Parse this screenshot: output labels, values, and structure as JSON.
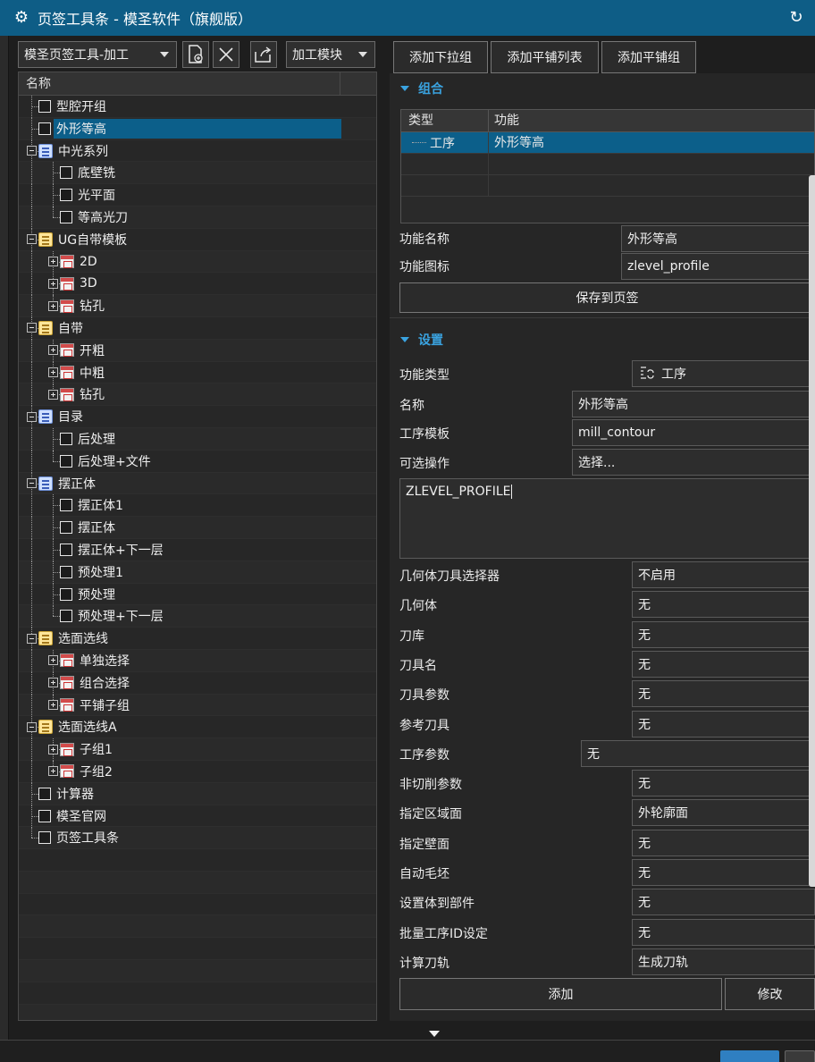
{
  "window": {
    "title": "页签工具条 - 模圣软件（旗舰版）"
  },
  "toolbar": {
    "tab_combo": "模圣页签工具-加工",
    "module_combo": "加工模块"
  },
  "top_buttons": {
    "add_dropdown_group": "添加下拉组",
    "add_tile_list": "添加平铺列表",
    "add_tile_group": "添加平铺组"
  },
  "tree": {
    "header": "名称",
    "items": [
      {
        "label": "型腔开组",
        "level": 1,
        "icon": "checkbox",
        "expander": ""
      },
      {
        "label": "外形等高",
        "level": 1,
        "icon": "checkbox",
        "expander": "",
        "selected": true
      },
      {
        "label": "中光系列",
        "level": 1,
        "icon": "list-blue",
        "expander": "minus"
      },
      {
        "label": "底壁铣",
        "level": 2,
        "icon": "checkbox",
        "expander": ""
      },
      {
        "label": "光平面",
        "level": 2,
        "icon": "checkbox",
        "expander": ""
      },
      {
        "label": "等高光刀",
        "level": 2,
        "icon": "checkbox",
        "expander": ""
      },
      {
        "label": "UG自带模板",
        "level": 1,
        "icon": "list-yellow",
        "expander": "minus"
      },
      {
        "label": "2D",
        "level": 2,
        "icon": "grid",
        "expander": "plus"
      },
      {
        "label": "3D",
        "level": 2,
        "icon": "grid",
        "expander": "plus"
      },
      {
        "label": "钻孔",
        "level": 2,
        "icon": "grid",
        "expander": "plus"
      },
      {
        "label": "自带",
        "level": 1,
        "icon": "list-yellow",
        "expander": "minus"
      },
      {
        "label": "开粗",
        "level": 2,
        "icon": "grid",
        "expander": "plus"
      },
      {
        "label": "中粗",
        "level": 2,
        "icon": "grid",
        "expander": "plus"
      },
      {
        "label": "钻孔",
        "level": 2,
        "icon": "grid",
        "expander": "plus"
      },
      {
        "label": "目录",
        "level": 1,
        "icon": "list-blue",
        "expander": "minus"
      },
      {
        "label": "后处理",
        "level": 2,
        "icon": "checkbox",
        "expander": ""
      },
      {
        "label": "后处理+文件",
        "level": 2,
        "icon": "checkbox",
        "expander": ""
      },
      {
        "label": "摆正体",
        "level": 1,
        "icon": "list-blue",
        "expander": "minus"
      },
      {
        "label": "摆正体1",
        "level": 2,
        "icon": "checkbox",
        "expander": ""
      },
      {
        "label": "摆正体",
        "level": 2,
        "icon": "checkbox",
        "expander": ""
      },
      {
        "label": "摆正体+下一层",
        "level": 2,
        "icon": "checkbox",
        "expander": ""
      },
      {
        "label": "预处理1",
        "level": 2,
        "icon": "checkbox",
        "expander": ""
      },
      {
        "label": "预处理",
        "level": 2,
        "icon": "checkbox",
        "expander": ""
      },
      {
        "label": "预处理+下一层",
        "level": 2,
        "icon": "checkbox",
        "expander": ""
      },
      {
        "label": "选面选线",
        "level": 1,
        "icon": "list-yellow",
        "expander": "minus"
      },
      {
        "label": "单独选择",
        "level": 2,
        "icon": "grid",
        "expander": "plus"
      },
      {
        "label": "组合选择",
        "level": 2,
        "icon": "grid",
        "expander": "plus"
      },
      {
        "label": "平铺子组",
        "level": 2,
        "icon": "grid",
        "expander": "plus"
      },
      {
        "label": "选面选线A",
        "level": 1,
        "icon": "list-yellow",
        "expander": "minus"
      },
      {
        "label": "子组1",
        "level": 2,
        "icon": "grid",
        "expander": "plus"
      },
      {
        "label": "子组2",
        "level": 2,
        "icon": "grid",
        "expander": "plus"
      },
      {
        "label": "计算器",
        "level": 1,
        "icon": "checkbox",
        "expander": ""
      },
      {
        "label": "模圣官网",
        "level": 1,
        "icon": "checkbox",
        "expander": ""
      },
      {
        "label": "页签工具条",
        "level": 1,
        "icon": "checkbox",
        "expander": ""
      }
    ]
  },
  "group_section": {
    "title": "组合",
    "col_type": "类型",
    "col_function": "功能",
    "row_type": "工序",
    "row_function": "外形等高",
    "name_label": "功能名称",
    "name_value": "外形等高",
    "icon_label": "功能图标",
    "icon_value": "zlevel_profile",
    "save_button": "保存到页签"
  },
  "settings_section": {
    "title": "设置",
    "func_type_label": "功能类型",
    "func_type_value": "工序",
    "name_label": "名称",
    "name_value": "外形等高",
    "template_label": "工序模板",
    "template_value": "mill_contour",
    "optional_label": "可选操作",
    "optional_value": "选择...",
    "textarea_value": "ZLEVEL_PROFILE",
    "rows": [
      {
        "label": "几何体刀具选择器",
        "value": "不启用"
      },
      {
        "label": "几何体",
        "value": "无"
      },
      {
        "label": "刀库",
        "value": "无"
      },
      {
        "label": "刀具名",
        "value": "无"
      },
      {
        "label": "刀具参数",
        "value": "无"
      },
      {
        "label": "参考刀具",
        "value": "无"
      },
      {
        "label": "工序参数",
        "value": "无"
      },
      {
        "label": "非切削参数",
        "value": "无"
      },
      {
        "label": "指定区域面",
        "value": "外轮廓面"
      },
      {
        "label": "指定壁面",
        "value": "无"
      },
      {
        "label": "自动毛坯",
        "value": "无"
      },
      {
        "label": "设置体到部件",
        "value": "无"
      },
      {
        "label": "批量工序ID设定",
        "value": "无"
      },
      {
        "label": "计算刀轨",
        "value": "生成刀轨"
      }
    ],
    "add_button": "添加",
    "modify_button": "修改"
  },
  "colors": {
    "titlebar": "#0e5d86",
    "selection": "#0c5f8a",
    "section_title": "#3aa3e0"
  }
}
